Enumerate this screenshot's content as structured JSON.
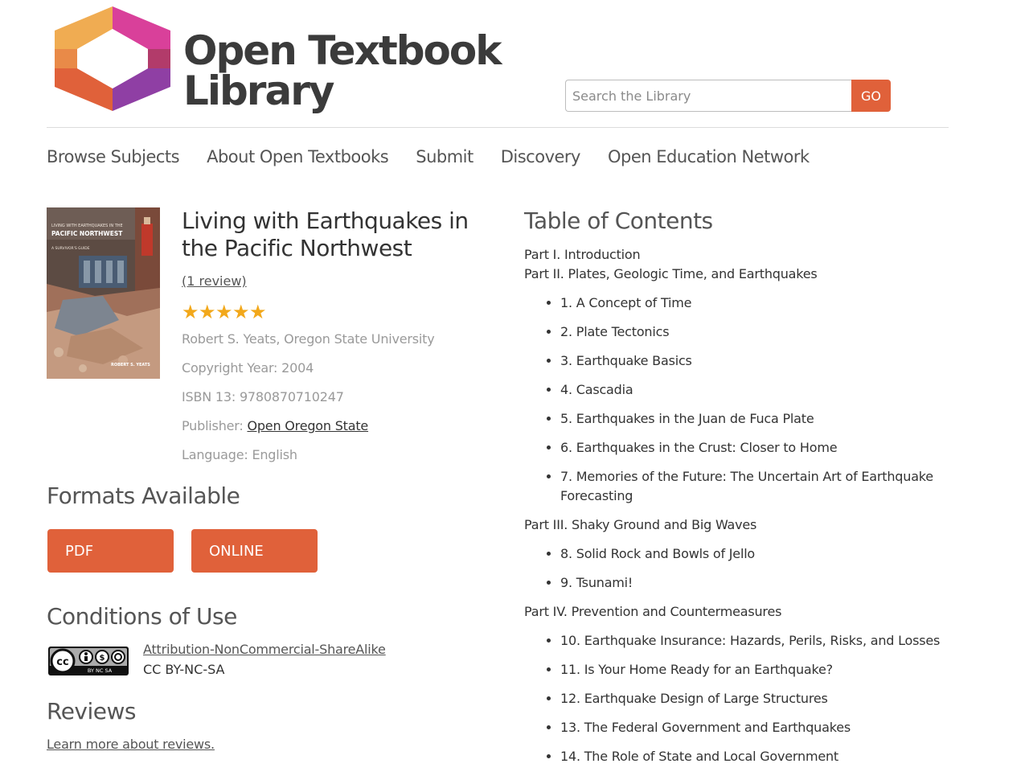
{
  "colors": {
    "accent": "#e0613a",
    "star": "#f2a81b",
    "text": "#333333",
    "muted": "#9a9a9a"
  },
  "header": {
    "brand_line1": "Open Textbook",
    "brand_line2": "Library",
    "search_placeholder": "Search the Library",
    "search_button": "GO"
  },
  "nav": [
    "Browse Subjects",
    "About Open Textbooks",
    "Submit",
    "Discovery",
    "Open Education Network"
  ],
  "book": {
    "title": "Living with Earthquakes in the Pacific Northwest",
    "review_link": "(1 review)",
    "rating": 5,
    "author": "Robert S. Yeats, Oregon State University",
    "copyright": "Copyright Year: 2004",
    "isbn": "ISBN 13: 9780870710247",
    "publisher_label": "Publisher: ",
    "publisher": "Open Oregon State",
    "language": "Language: English",
    "cover": {
      "line1": "LIVING WITH EARTHQUAKES IN THE",
      "line2": "PACIFIC NORTHWEST",
      "line3": "A SURVIVOR'S GUIDE",
      "author": "ROBERT S. YEATS"
    }
  },
  "formats": {
    "heading": "Formats Available",
    "pdf": "PDF",
    "online": "ONLINE"
  },
  "conditions": {
    "heading": "Conditions of Use",
    "license_name": "Attribution-NonCommercial-ShareAlike",
    "license_code": "CC BY-NC-SA",
    "badge_text": "BY NC SA"
  },
  "reviews": {
    "heading": "Reviews",
    "learn_link": "Learn more about reviews."
  },
  "toc": {
    "heading": "Table of Contents",
    "parts": [
      {
        "title": "Part I. Introduction",
        "chapters": []
      },
      {
        "title": "Part II. Plates, Geologic Time, and Earthquakes",
        "chapters": [
          "1. A Concept of Time",
          "2. Plate Tectonics",
          "3. Earthquake Basics",
          "4. Cascadia",
          "5. Earthquakes in the Juan de Fuca Plate",
          "6. Earthquakes in the Crust: Closer to Home",
          "7. Memories of the Future: The Uncertain Art of Earthquake Forecasting"
        ]
      },
      {
        "title": "Part III. Shaky Ground and Big Waves",
        "chapters": [
          "8. Solid Rock and Bowls of Jello",
          "9. Tsunami!"
        ]
      },
      {
        "title": "Part IV. Prevention and Countermeasures",
        "chapters": [
          "10. Earthquake Insurance: Hazards, Perils, Risks, and Losses",
          "11. Is Your Home Ready for an Earthquake?",
          "12. Earthquake Design of Large Structures",
          "13. The Federal Government and Earthquakes",
          "14. The Role of State and Local Government"
        ]
      }
    ]
  }
}
